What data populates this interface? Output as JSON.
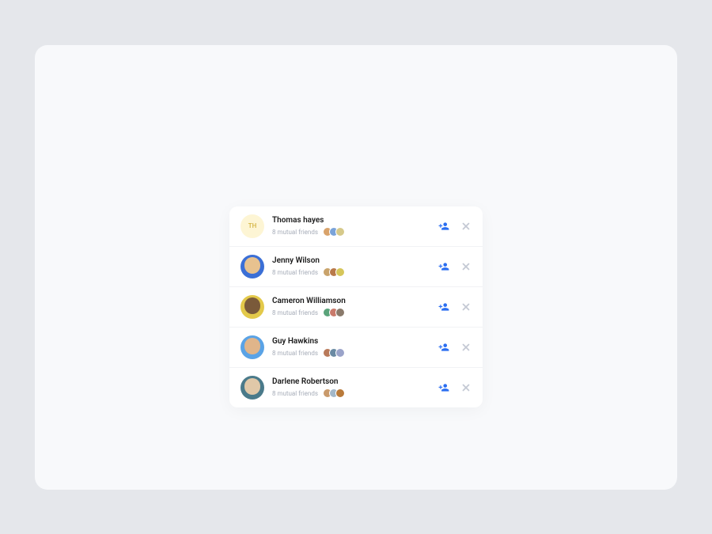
{
  "suggestions": [
    {
      "name": "Thomas hayes",
      "mutual_text": "8 mutual friends",
      "initials": "TH",
      "avatar_type": "initials",
      "avatar_bg": "#fdf5d4",
      "mini_colors": [
        "#d9a36b",
        "#7aa3d9",
        "#d6c98a"
      ]
    },
    {
      "name": "Jenny Wilson",
      "mutual_text": "8 mutual friends",
      "avatar_type": "image",
      "avatar_bg": "#3b6fd6",
      "avatar_inner": "#e8c28f",
      "mini_colors": [
        "#c9a36b",
        "#b97a4a",
        "#d6c65a"
      ]
    },
    {
      "name": "Cameron Williamson",
      "mutual_text": "8 mutual friends",
      "avatar_type": "image",
      "avatar_bg": "#e3c94a",
      "avatar_inner": "#7a5a3a",
      "mini_colors": [
        "#5aa37a",
        "#c97a6b",
        "#8a7a6b"
      ]
    },
    {
      "name": "Guy Hawkins",
      "mutual_text": "8 mutual friends",
      "avatar_type": "image",
      "avatar_bg": "#5aa3e6",
      "avatar_inner": "#e0b58a",
      "mini_colors": [
        "#b97a5a",
        "#6a8aa3",
        "#9aa3c9"
      ]
    },
    {
      "name": "Darlene Robertson",
      "mutual_text": "8 mutual friends",
      "avatar_type": "image",
      "avatar_bg": "#4a7a8a",
      "avatar_inner": "#e0c8a8",
      "mini_colors": [
        "#c99a6b",
        "#a3b8c9",
        "#b97a3a"
      ]
    }
  ],
  "colors": {
    "accent": "#2a6ef1",
    "muted": "#c4c9d4"
  }
}
